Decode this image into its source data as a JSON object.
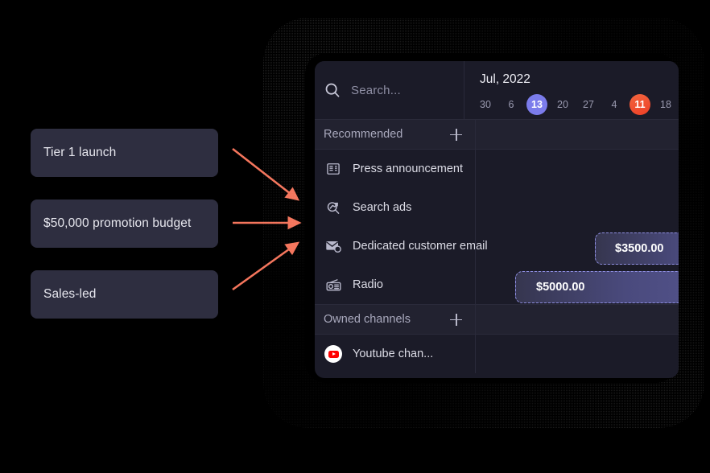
{
  "cards": [
    {
      "label": "Tier 1 launch"
    },
    {
      "label": "$50,000 promotion budget"
    },
    {
      "label": "Sales-led"
    }
  ],
  "panel": {
    "search": {
      "placeholder": "Search...",
      "value": "",
      "icon": "search-icon"
    },
    "calendar": {
      "month_label": "Jul, 2022",
      "days": [
        {
          "label": "30",
          "state": "normal"
        },
        {
          "label": "6",
          "state": "normal"
        },
        {
          "label": "13",
          "state": "selected-purple"
        },
        {
          "label": "20",
          "state": "normal"
        },
        {
          "label": "27",
          "state": "normal"
        },
        {
          "label": "4",
          "state": "normal"
        },
        {
          "label": "11",
          "state": "selected-orange"
        },
        {
          "label": "18",
          "state": "normal"
        }
      ]
    },
    "sections": [
      {
        "title": "Recommended",
        "add_icon": "plus-icon",
        "rows": [
          {
            "name": "Press announcement",
            "icon": "newspaper-icon",
            "bar": null
          },
          {
            "name": "Search ads",
            "icon": "search-ads-icon",
            "bar": null
          },
          {
            "name": "Dedicated customer email",
            "icon": "email-icon",
            "bar": {
              "label": "$3500.00"
            }
          },
          {
            "name": "Radio",
            "icon": "radio-icon",
            "bar": {
              "label": "$5000.00"
            }
          }
        ]
      },
      {
        "title": "Owned channels",
        "add_icon": "plus-icon",
        "rows": [
          {
            "name": "Youtube chan...",
            "icon": "youtube-icon",
            "bar": null
          }
        ]
      }
    ]
  },
  "colors": {
    "background": "#000000",
    "panel_bg": "#1b1b28",
    "section_bg": "#222230",
    "card_bg": "#2e2e40",
    "arrow": "#f4755c",
    "pill_purple": "#7b7ceb",
    "pill_orange": "#ee3f26",
    "bar_border": "#8e8ee0",
    "youtube_red": "#ff0000"
  }
}
